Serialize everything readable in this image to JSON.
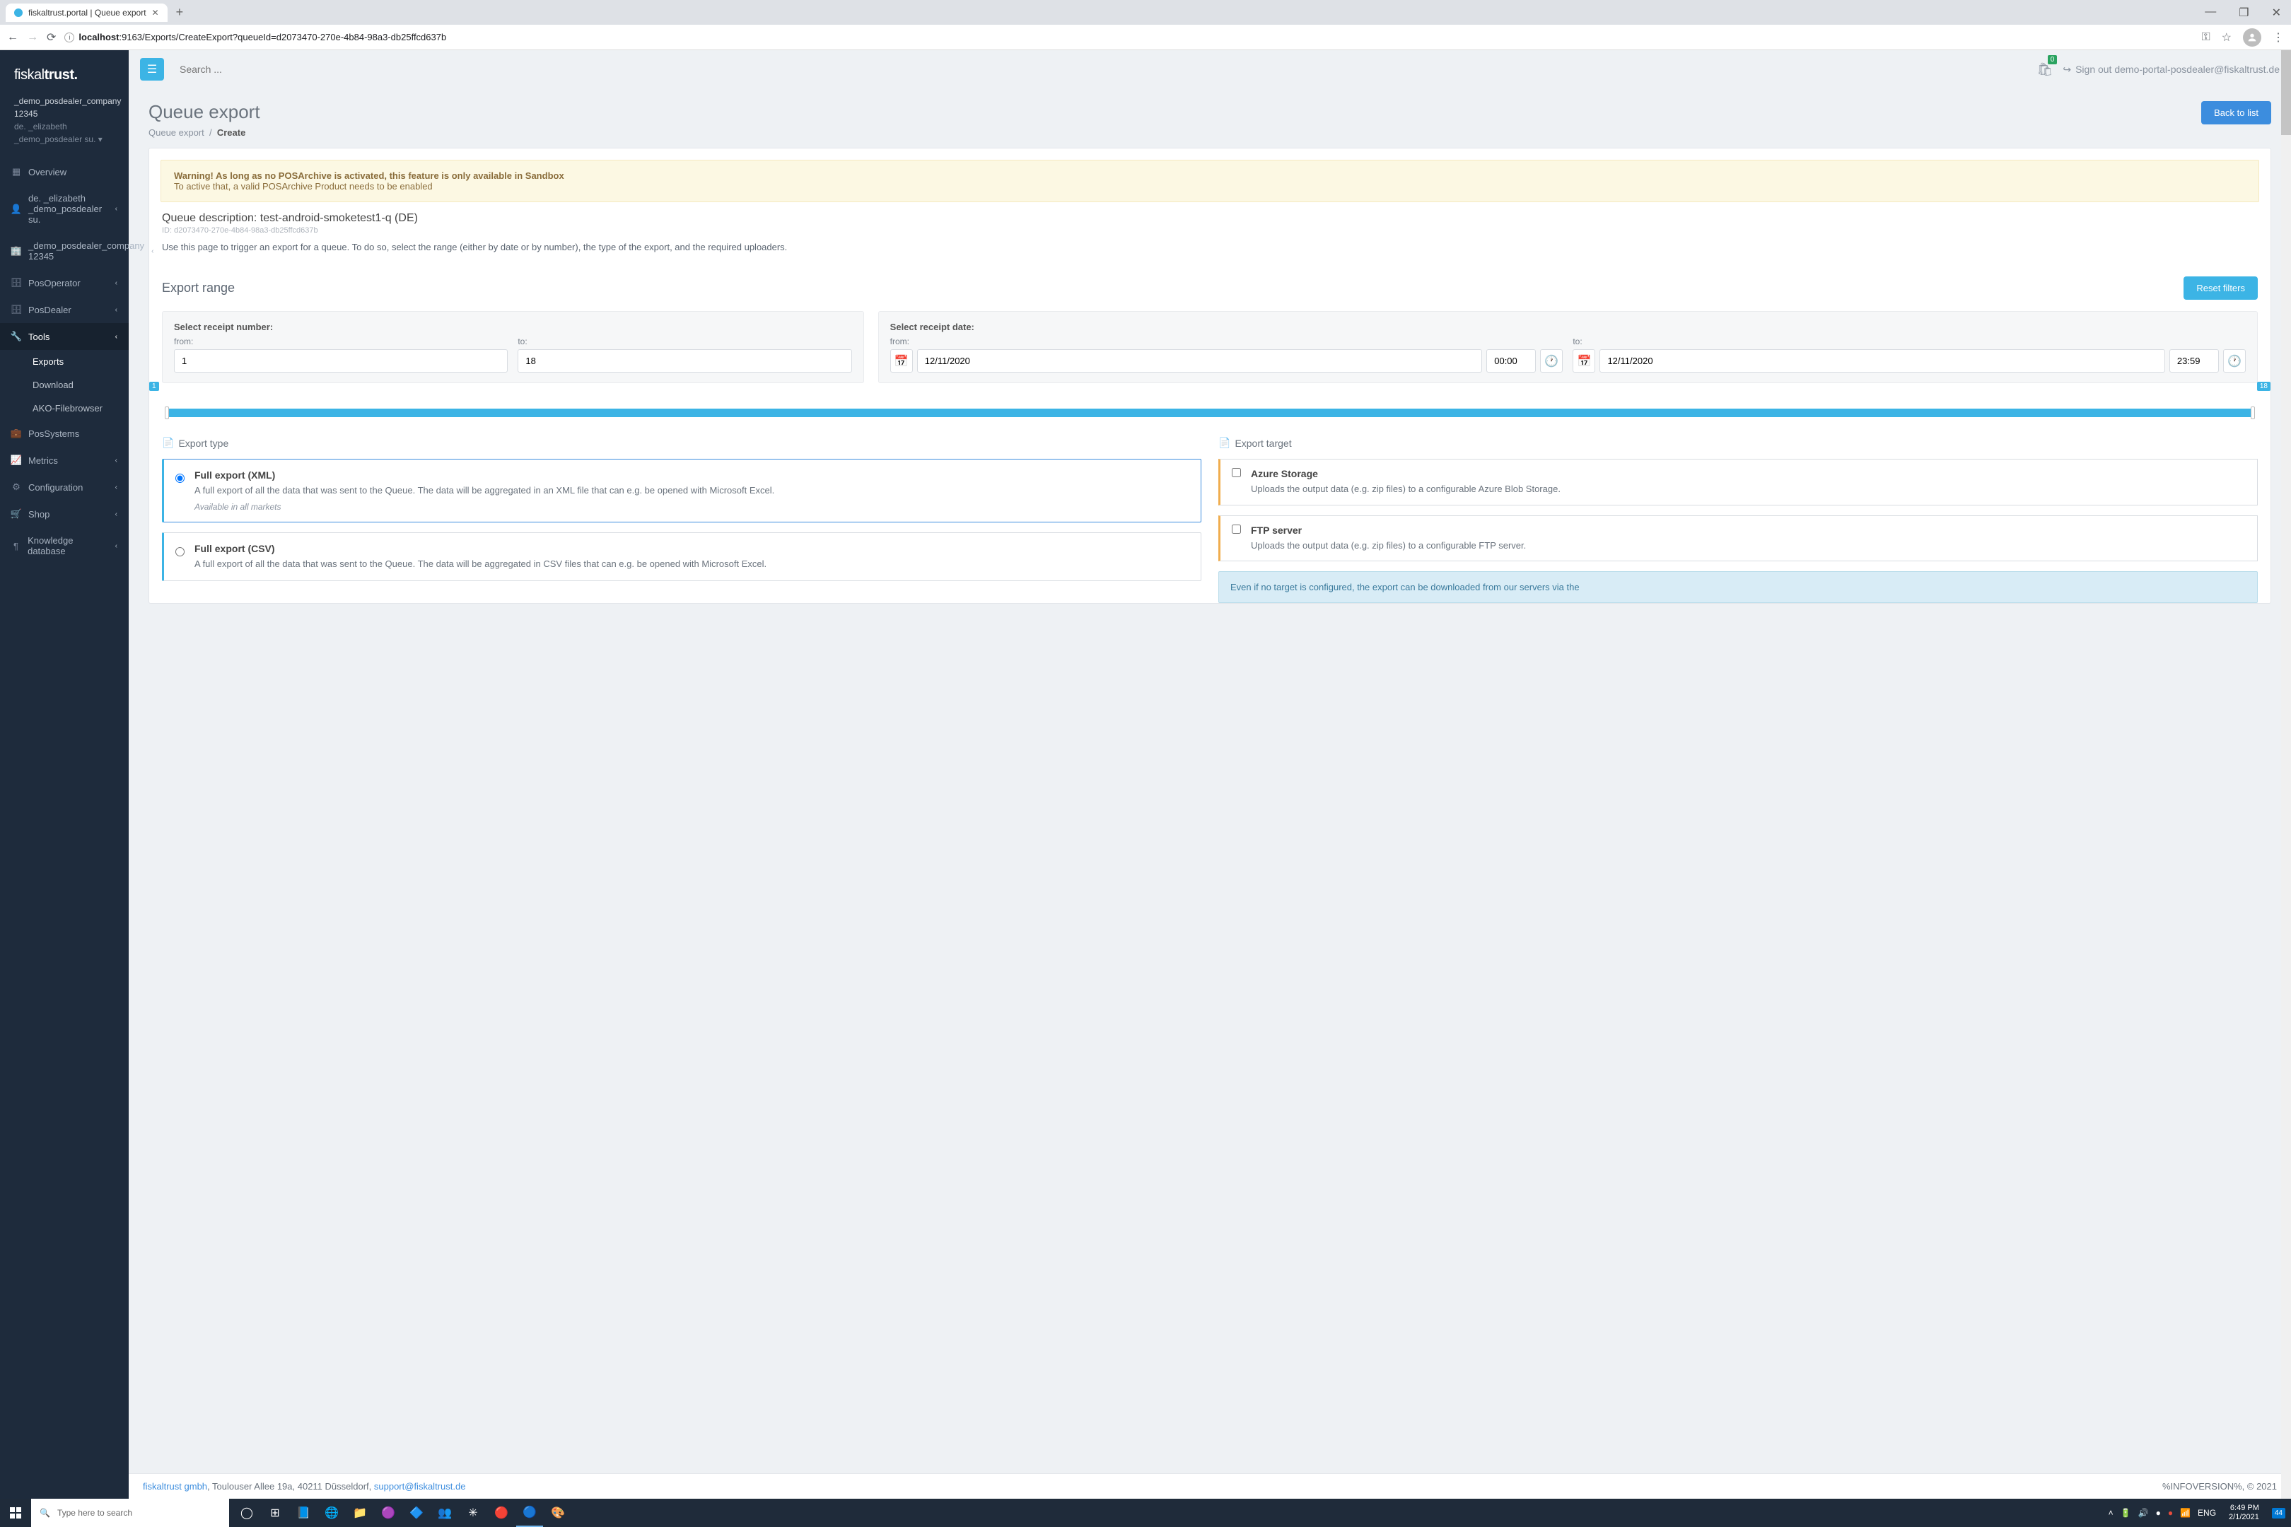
{
  "browser": {
    "tab_title": "fiskaltrust.portal | Queue export",
    "url_host": "localhost",
    "url_port": ":9163",
    "url_path": "/Exports/CreateExport?queueId=d2073470-270e-4b84-98a3-db25ffcd637b"
  },
  "topbar": {
    "search_placeholder": "Search ...",
    "cart_count": "0",
    "signout_label": "Sign out demo-portal-posdealer@fiskaltrust.de"
  },
  "sidebar": {
    "logo_a": "fiskal",
    "logo_b": "trust.",
    "company": "_demo_posdealer_company 12345",
    "user_line1": "de. _elizabeth",
    "user_line2": "_demo_posdealer su.",
    "items": [
      {
        "icon": "▦",
        "label": "Overview",
        "chev": ""
      },
      {
        "icon": "👤",
        "label": "de. _elizabeth _demo_posdealer su.",
        "chev": "‹"
      },
      {
        "icon": "🏢",
        "label": "_demo_posdealer_company 12345",
        "chev": "‹"
      },
      {
        "icon": "🗄",
        "label": "PosOperator",
        "chev": "‹"
      },
      {
        "icon": "🗄",
        "label": "PosDealer",
        "chev": "‹"
      },
      {
        "icon": "🔧",
        "label": "Tools",
        "chev": "‹"
      },
      {
        "icon": "💼",
        "label": "PosSystems",
        "chev": ""
      },
      {
        "icon": "📈",
        "label": "Metrics",
        "chev": "‹"
      },
      {
        "icon": "⚙",
        "label": "Configuration",
        "chev": "‹"
      },
      {
        "icon": "🛒",
        "label": "Shop",
        "chev": "‹"
      },
      {
        "icon": "¶",
        "label": "Knowledge database",
        "chev": "‹"
      }
    ],
    "tools_sub": [
      "Exports",
      "Download",
      "AKO-Filebrowser"
    ]
  },
  "page": {
    "title": "Queue export",
    "crumb1": "Queue export",
    "crumb2": "Create",
    "back_btn": "Back to list"
  },
  "alert": {
    "line1_bold": "Warning! As long as no POSArchive is activated, this feature is only available in Sandbox",
    "line2": "To active that, a valid POSArchive Product needs to be enabled"
  },
  "queue": {
    "desc": "Queue description: test-android-smoketest1-q (DE)",
    "id": "ID: d2073470-270e-4b84-98a3-db25ffcd637b",
    "help": "Use this page to trigger an export for a queue. To do so, select the range (either by date or by number), the type of the export, and the required uploaders."
  },
  "range": {
    "title": "Export range",
    "reset_btn": "Reset filters",
    "receipt_label": "Select receipt number:",
    "date_label": "Select receipt date:",
    "from_label": "from:",
    "to_label": "to:",
    "from_val": "1",
    "to_val": "18",
    "date_from": "12/11/2020",
    "time_from": "00:00",
    "date_to": "12/11/2020",
    "time_to": "23:59",
    "slider_min": "1",
    "slider_max": "18"
  },
  "export_type": {
    "title": "Export type",
    "options": [
      {
        "title": "Full export (XML)",
        "desc": "A full export of all the data that was sent to the Queue. The data will be aggregated in an XML file that can e.g. be opened with Microsoft Excel.",
        "note": "Available in all markets",
        "selected": true
      },
      {
        "title": "Full export (CSV)",
        "desc": "A full export of all the data that was sent to the Queue. The data will be aggregated in CSV files that can e.g. be opened with Microsoft Excel.",
        "note": "",
        "selected": false
      }
    ]
  },
  "export_target": {
    "title": "Export target",
    "targets": [
      {
        "title": "Azure Storage",
        "desc": "Uploads the output data (e.g. zip files) to a configurable Azure Blob Storage."
      },
      {
        "title": "FTP server",
        "desc": "Uploads the output data (e.g. zip files) to a configurable FTP server."
      }
    ],
    "info": "Even if no target is configured, the export can be downloaded from our servers via the"
  },
  "footer": {
    "company": "fiskaltrust gmbh",
    "addr": ", Toulouser Allee 19a, 40211 Düsseldorf, ",
    "email": "support@fiskaltrust.de",
    "version": "%INFOVERSION%, © 2021"
  },
  "taskbar": {
    "search_placeholder": "Type here to search",
    "lang": "ENG",
    "time": "6:49 PM",
    "date": "2/1/2021",
    "notif": "44"
  }
}
